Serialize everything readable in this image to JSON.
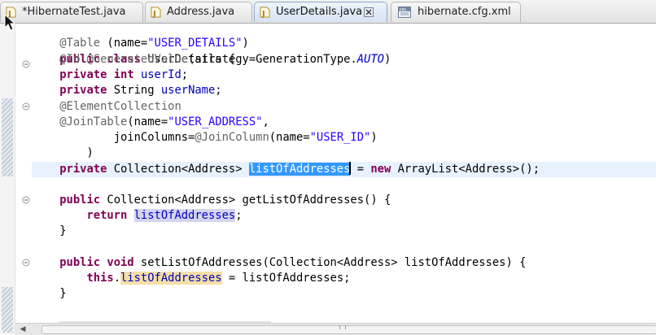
{
  "tabs": [
    {
      "label": "*HibernateTest.java",
      "closable": false
    },
    {
      "label": "Address.java",
      "closable": false
    },
    {
      "label": "UserDetails.java",
      "closable": true,
      "active": true
    },
    {
      "label": "hibernate.cfg.xml",
      "closable": false
    }
  ],
  "colors": {
    "keyword": "#7f0055",
    "string": "#2a00ff",
    "annotation": "#646464",
    "field": "#0000c0",
    "selection": "#3399ff",
    "current_line": "#e8f2fe"
  },
  "code": {
    "l1": {
      "ann": "@Table",
      "t1": " (name=",
      "s1": "\"USER_DETAILS\"",
      "t2": ")"
    },
    "l2": {
      "k1": "public",
      "k2": "class",
      "name": " UserDetails {"
    },
    "l3": {
      "a1": "@Id",
      "a2": "@GeneratedValue",
      "t1": "(strategy=GenerationType.",
      "c1": "AUTO",
      "t2": ")"
    },
    "l4": {
      "k1": "private",
      "k2": "int",
      "f1": "userId",
      "t1": ";"
    },
    "l5": {
      "k1": "private",
      "t1": " String ",
      "f1": "userName",
      "t2": ";"
    },
    "l6": {
      "a1": "@ElementCollection"
    },
    "l7": {
      "a1": "@JoinTable",
      "t1": "(name=",
      "s1": "\"USER_ADDRESS\"",
      "t2": ","
    },
    "l8": {
      "t1": "joinColumns=",
      "a1": "@JoinColumn",
      "t2": "(name=",
      "s1": "\"USER_ID\"",
      "t3": ")"
    },
    "l9": {
      "t1": ")"
    },
    "l10": {
      "k1": "private",
      "t1": " Collection<Address> ",
      "sel": "listOfAddresses",
      "t2": " = ",
      "k2": "new",
      "t3": " ArrayList<Address>();"
    },
    "l11": {
      "k1": "public",
      "t1": " Collection<Address> getListOfAddresses() {"
    },
    "l12": {
      "k1": "return",
      "occ": "listOfAddresses",
      "t1": ";"
    },
    "l13": {
      "t1": "}"
    },
    "l14": {
      "k1": "public",
      "k2": "void",
      "t1": " setListOfAddresses(Collection<Address> listOfAddresses) {"
    },
    "l15": {
      "k1": "this",
      "t1": ".",
      "occ": "listOfAddresses",
      "t2": " = listOfAddresses;"
    },
    "l16": {
      "t1": "}"
    }
  }
}
